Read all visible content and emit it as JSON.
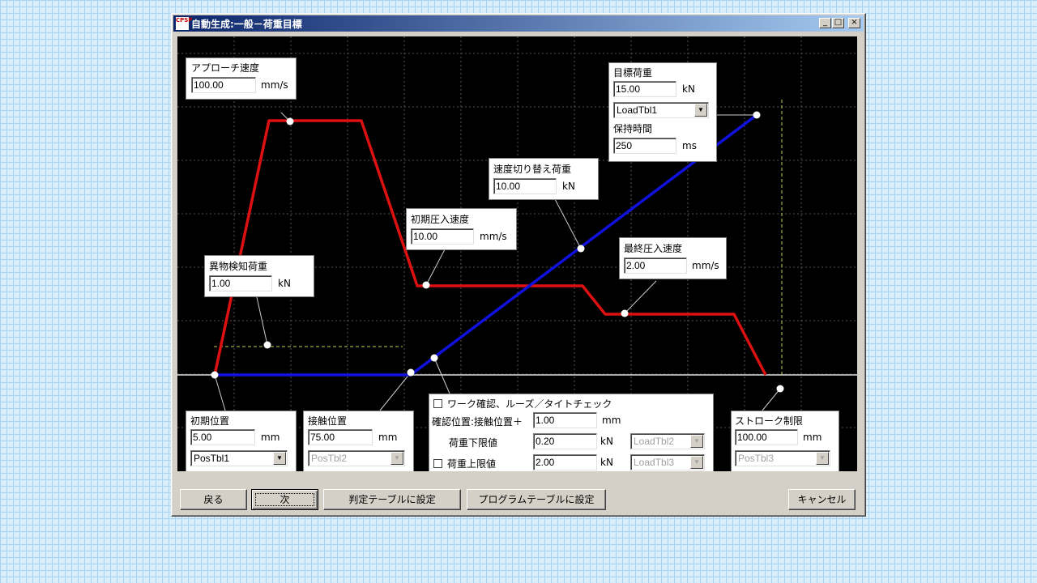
{
  "window": {
    "title": "自動生成:一般－荷重目標",
    "icon_text": "CPSP"
  },
  "title_buttons": {
    "minimize": "_",
    "maximize": "□",
    "close": "×"
  },
  "panels": {
    "approach_speed": {
      "label": "アプローチ速度",
      "value": "100.00",
      "unit": "mm/s"
    },
    "target_load": {
      "label": "目標荷重",
      "value": "15.00",
      "unit": "kN",
      "table": "LoadTbl1",
      "hold_label": "保持時間",
      "hold_value": "250",
      "hold_unit": "ms"
    },
    "switch_load": {
      "label": "速度切り替え荷重",
      "value": "10.00",
      "unit": "kN"
    },
    "initial_press_speed": {
      "label": "初期圧入速度",
      "value": "10.00",
      "unit": "mm/s"
    },
    "final_press_speed": {
      "label": "最終圧入速度",
      "value": "2.00",
      "unit": "mm/s"
    },
    "foreign_detect_load": {
      "label": "異物検知荷重",
      "value": "1.00",
      "unit": "kN"
    },
    "initial_position": {
      "label": "初期位置",
      "value": "5.00",
      "unit": "mm",
      "table": "PosTbl1"
    },
    "contact_position": {
      "label": "接触位置",
      "value": "75.00",
      "unit": "mm",
      "table": "PosTbl2"
    },
    "work_check": {
      "checkbox_label": "ワーク確認、ルーズ／タイトチェック",
      "confirm_label": "確認位置:接触位置＋",
      "confirm_value": "1.00",
      "confirm_unit": "mm",
      "lower_label": "荷重下限値",
      "lower_value": "0.20",
      "lower_unit": "kN",
      "lower_table": "LoadTbl2",
      "upper_label": "荷重上限値",
      "upper_value": "2.00",
      "upper_unit": "kN",
      "upper_table": "LoadTbl3"
    },
    "stroke_limit": {
      "label": "ストローク制限",
      "value": "100.00",
      "unit": "mm",
      "table": "PosTbl3"
    }
  },
  "buttons": {
    "back": "戻る",
    "next": "次",
    "judge_table": "判定テーブルに設定",
    "program_table": "プログラムテーブルに設定",
    "cancel": "キャンセル"
  },
  "colors": {
    "speed_line": "#dd1111",
    "load_line": "#1111dd",
    "plot_bg": "#000000",
    "grid": "#555555"
  }
}
